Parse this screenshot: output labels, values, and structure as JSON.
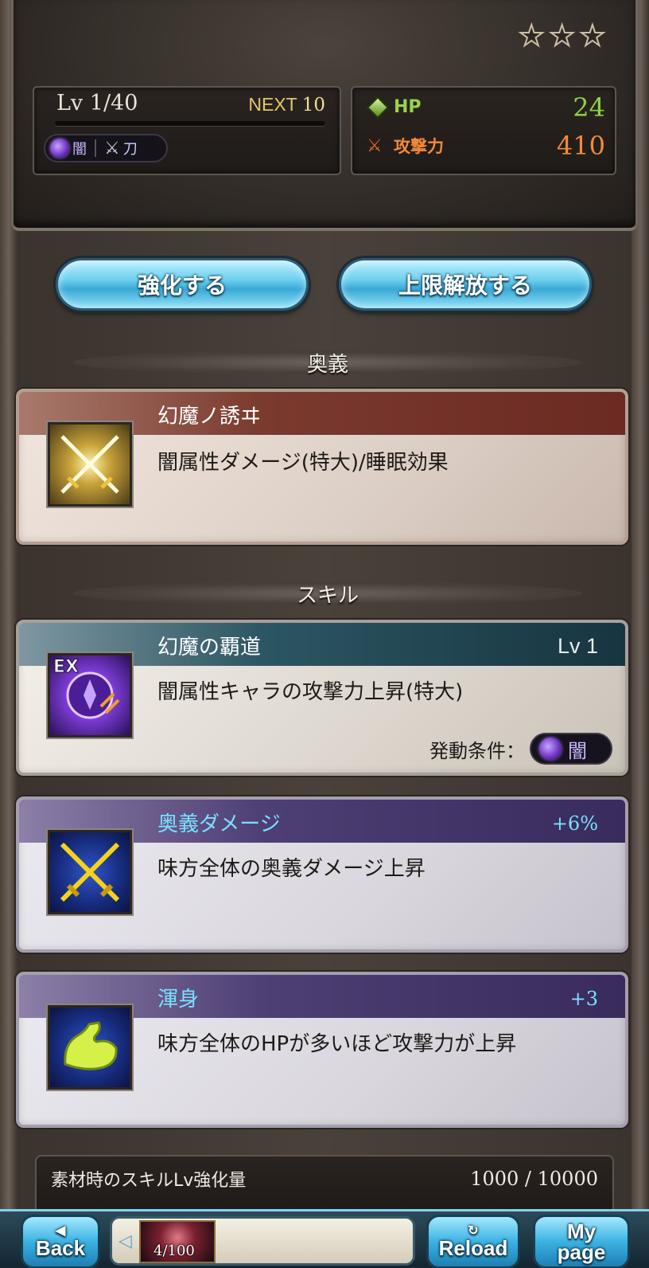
{
  "header": {
    "rarity_stars": 3,
    "level": "Lv 1/40",
    "next_label": "NEXT",
    "next_value": "10",
    "exp_progress": 0.0,
    "element": "闇",
    "weapon_type": "刀",
    "hp_label": "HP",
    "hp_value": "24",
    "atk_label": "攻撃力",
    "atk_value": "410"
  },
  "buttons": {
    "upgrade": "強化する",
    "limit_break": "上限解放する"
  },
  "sections": {
    "ougi": "奥義",
    "skill": "スキル"
  },
  "ougi": {
    "name": "幻魔ノ誘ヰ",
    "description": "闇属性ダメージ(特大)/睡眠効果"
  },
  "skills": [
    {
      "badge": "EX",
      "name": "幻魔の覇道",
      "level": "Lv 1",
      "description": "闇属性キャラの攻撃力上昇(特大)",
      "condition_label": "発動条件：",
      "condition_element": "闇"
    },
    {
      "name": "奥義ダメージ",
      "bonus": "+6%",
      "description": "味方全体の奥義ダメージ上昇"
    },
    {
      "name": "渾身",
      "bonus": "+3",
      "description": "味方全体のHPが多いほど攻撃力が上昇"
    }
  ],
  "material": {
    "label": "素材時のスキルLv強化量",
    "value": "1000 / 10000"
  },
  "bottom_nav": {
    "back": "Back",
    "reload": "Reload",
    "mypage_line1": "My",
    "mypage_line2": "page",
    "count": "4/100"
  },
  "colors": {
    "accent_button": "#3aa9d6",
    "hp": "#8fd43f",
    "atk": "#f08a3e",
    "dark_element": "#6a2fbf"
  }
}
